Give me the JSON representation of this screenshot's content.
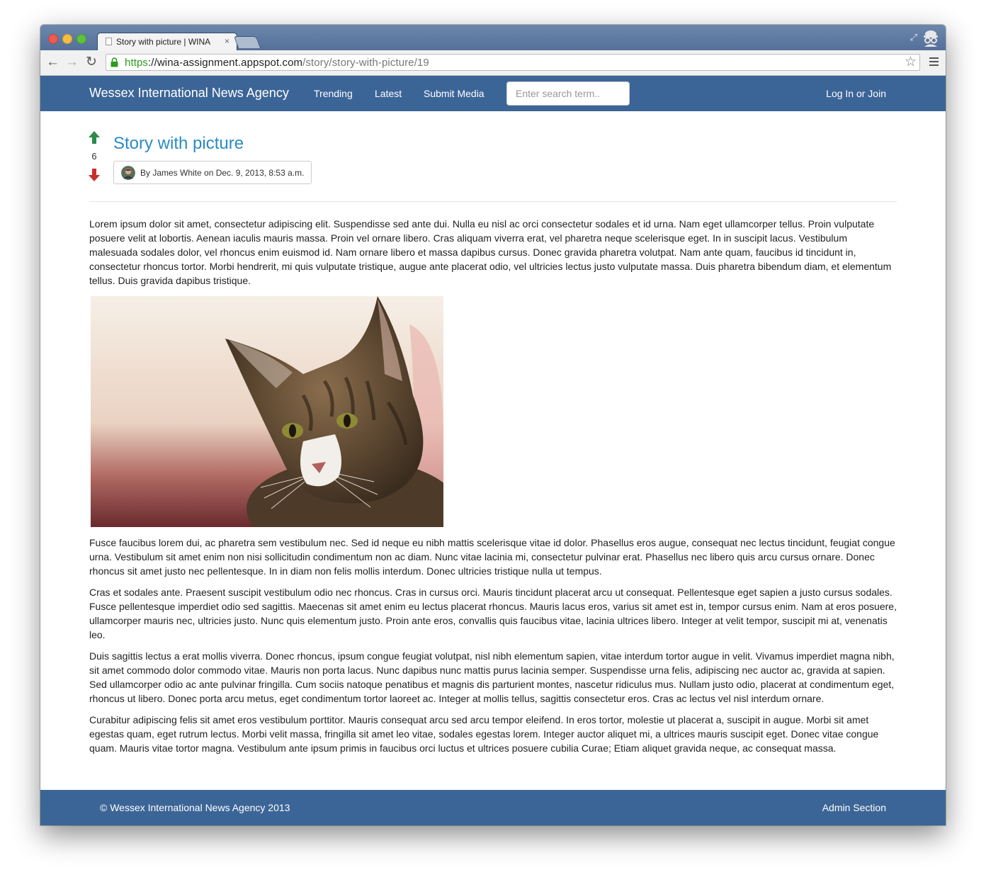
{
  "browser": {
    "tab_title": "Story with picture | WINA",
    "tab_close": "×",
    "url_scheme": "https",
    "url_separator": "://",
    "url_host": "wina-assignment.appspot.com",
    "url_path": "/story/story-with-picture/19"
  },
  "nav": {
    "brand": "Wessex International News Agency",
    "links": [
      "Trending",
      "Latest",
      "Submit Media"
    ],
    "search_placeholder": "Enter search term..",
    "login": "Log In or Join"
  },
  "story": {
    "title": "Story with picture",
    "votes": "6",
    "byline": "By James White on Dec. 9, 2013, 8:53 a.m.",
    "colors": {
      "upvote": "#2e8b4a",
      "downvote": "#c9302c",
      "title": "#2a8bc4",
      "navbar": "#3c6597"
    },
    "paragraph_intro": "Lorem ipsum dolor sit amet, consectetur adipiscing elit. Suspendisse sed ante dui. Nulla eu nisl ac orci consectetur sodales et id urna. Nam eget ullamcorper tellus. Proin vulputate posuere velit at lobortis. Aenean iaculis mauris massa. Proin vel ornare libero. Cras aliquam viverra erat, vel pharetra neque scelerisque eget. In in suscipit lacus. Vestibulum malesuada sodales dolor, vel rhoncus enim euismod id. Nam ornare libero et massa dapibus cursus. Donec gravida pharetra volutpat. Nam ante quam, faucibus id tincidunt in, consectetur rhoncus tortor. Morbi hendrerit, mi quis vulputate tristique, augue ante placerat odio, vel ultricies lectus justo vulputate massa. Duis pharetra bibendum diam, et elementum tellus. Duis gravida dapibus tristique.",
    "paragraphs": [
      "Fusce faucibus lorem dui, ac pharetra sem vestibulum nec. Sed id neque eu nibh mattis scelerisque vitae id dolor. Phasellus eros augue, consequat nec lectus tincidunt, feugiat congue urna. Vestibulum sit amet enim non nisi sollicitudin condimentum non ac diam. Nunc vitae lacinia mi, consectetur pulvinar erat. Phasellus nec libero quis arcu cursus ornare. Donec rhoncus sit amet justo nec pellentesque. In in diam non felis mollis interdum. Donec ultricies tristique nulla ut tempus.",
      "Cras et sodales ante. Praesent suscipit vestibulum odio nec rhoncus. Cras in cursus orci. Mauris tincidunt placerat arcu ut consequat. Pellentesque eget sapien a justo cursus sodales. Fusce pellentesque imperdiet odio sed sagittis. Maecenas sit amet enim eu lectus placerat rhoncus. Mauris lacus eros, varius sit amet est in, tempor cursus enim. Nam at eros posuere, ullamcorper mauris nec, ultricies justo. Nunc quis elementum justo. Proin ante eros, convallis quis faucibus vitae, lacinia ultrices libero. Integer at velit tempor, suscipit mi at, venenatis leo.",
      "Duis sagittis lectus a erat mollis viverra. Donec rhoncus, ipsum congue feugiat volutpat, nisl nibh elementum sapien, vitae interdum tortor augue in velit. Vivamus imperdiet magna nibh, sit amet commodo dolor commodo vitae. Mauris non porta lacus. Nunc dapibus nunc mattis purus lacinia semper. Suspendisse urna felis, adipiscing nec auctor ac, gravida at sapien. Sed ullamcorper odio ac ante pulvinar fringilla. Cum sociis natoque penatibus et magnis dis parturient montes, nascetur ridiculus mus. Nullam justo odio, placerat at condimentum eget, rhoncus ut libero. Donec porta arcu metus, eget condimentum tortor laoreet ac. Integer at mollis tellus, sagittis consectetur eros. Cras ac lectus vel nisl interdum ornare.",
      "Curabitur adipiscing felis sit amet eros vestibulum porttitor. Mauris consequat arcu sed arcu tempor eleifend. In eros tortor, molestie ut placerat a, suscipit in augue. Morbi sit amet egestas quam, eget rutrum lectus. Morbi velit massa, fringilla sit amet leo vitae, sodales egestas lorem. Integer auctor aliquet mi, a ultrices mauris suscipit eget. Donec vitae congue quam. Mauris vitae tortor magna. Vestibulum ante ipsum primis in faucibus orci luctus et ultrices posuere cubilia Curae; Etiam aliquet gravida neque, ac consequat massa."
    ]
  },
  "footer": {
    "copyright": "© Wessex International News Agency 2013",
    "admin": "Admin Section"
  }
}
